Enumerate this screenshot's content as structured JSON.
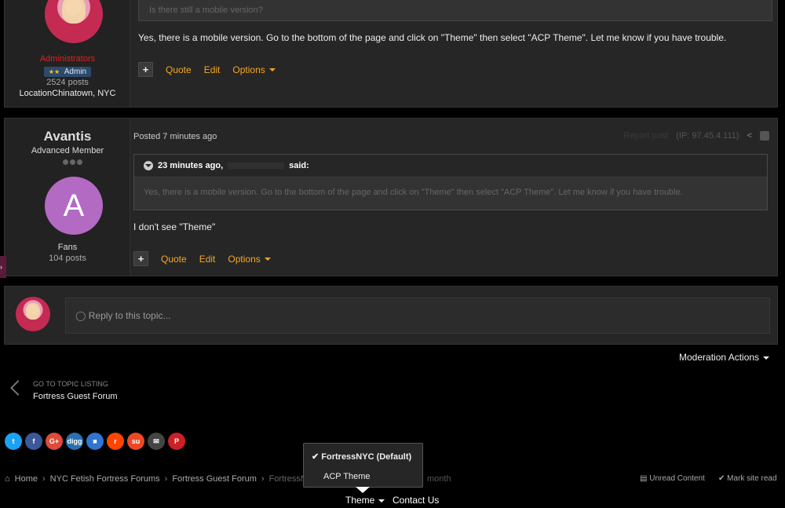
{
  "post1": {
    "quote_placeholder": "Is there still a mobile version?",
    "body": "Yes, there is a mobile version. Go to the bottom of the page and click on \"Theme\" then select \"ACP Theme\". Let me know if you have trouble.",
    "author_group": "Administrators",
    "badge_stars": "★★",
    "badge_label": "Admin",
    "posts_count": "2524 posts",
    "location_label": "Location",
    "location_value": "Chinatown, NYC",
    "plus": "+",
    "quote": "Quote",
    "edit": "Edit",
    "options": "Options"
  },
  "post2": {
    "author_name": "Avantis",
    "author_title": "Advanced Member",
    "avatar_letter": "A",
    "avatar_color": "#b26ac3",
    "posted": "Posted 7 minutes ago",
    "report": "Report post",
    "ip": "(IP: 97.45.4.111)",
    "quote_time": "23 minutes ago,",
    "quote_said": "said:",
    "quote_body": "Yes, there is a mobile version. Go to the bottom of the page and click on \"Theme\" then select \"ACP Theme\". Let me know if you have trouble.",
    "body": "I don't see \"Theme\"",
    "group": "Fans",
    "posts_count": "104 posts",
    "plus": "+",
    "quote": "Quote",
    "edit": "Edit",
    "options": "Options"
  },
  "reply": {
    "placeholder": "Reply to this topic..."
  },
  "moderation": "Moderation Actions",
  "topic_nav": {
    "label": "GO TO TOPIC LISTING",
    "forum": "Fortress Guest Forum"
  },
  "social": [
    {
      "name": "twitter-icon",
      "glyph": "t",
      "color": "#1da1f2"
    },
    {
      "name": "facebook-icon",
      "glyph": "f",
      "color": "#3b5998"
    },
    {
      "name": "google-plus-icon",
      "glyph": "G+",
      "color": "#dd4b39"
    },
    {
      "name": "digg-icon",
      "glyph": "digg",
      "color": "#2a6fb0"
    },
    {
      "name": "delicious-icon",
      "glyph": "■",
      "color": "#3274d1"
    },
    {
      "name": "reddit-icon",
      "glyph": "r",
      "color": "#ff4500"
    },
    {
      "name": "stumbleupon-icon",
      "glyph": "su",
      "color": "#eb4924"
    },
    {
      "name": "email-icon",
      "glyph": "✉",
      "color": "#444444"
    },
    {
      "name": "pinterest-icon",
      "glyph": "P",
      "color": "#cb2027"
    }
  ],
  "breadcrumb": {
    "home": "Home",
    "forums": "NYC Fetish Fortress Forums",
    "guest": "Fortress Guest Forum",
    "current": "FortressNYC",
    "month": "month"
  },
  "footer_links": {
    "unread": "Unread Content",
    "mark_read": "Mark site read"
  },
  "theme_menu": {
    "label": "Theme",
    "items": [
      "FortressNYC (Default)",
      "ACP Theme"
    ],
    "check": "✔"
  },
  "contact": "Contact Us"
}
